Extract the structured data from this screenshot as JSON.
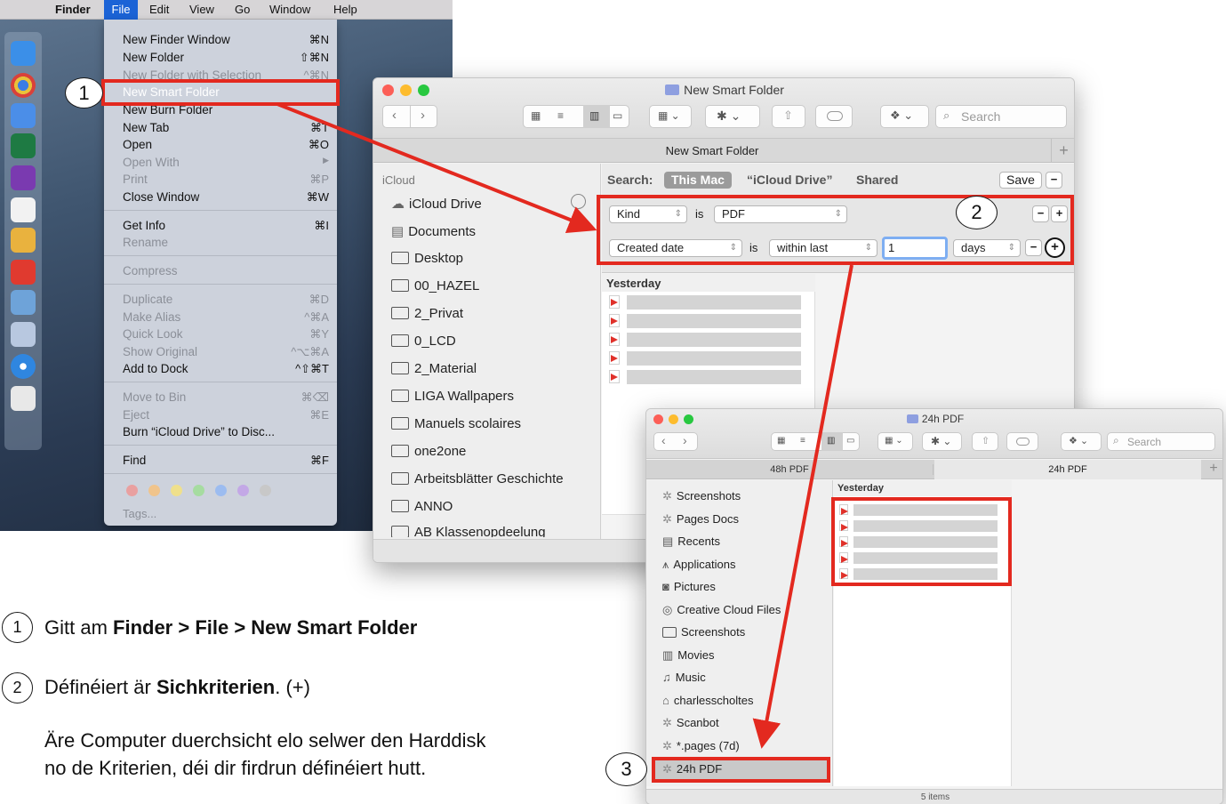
{
  "menubar": {
    "app_name": "Finder",
    "items": [
      "File",
      "Edit",
      "View",
      "Go",
      "Window",
      "Help"
    ]
  },
  "file_menu": {
    "items": [
      {
        "label": "New Finder Window",
        "shortcut": "⌘N",
        "enabled": true
      },
      {
        "label": "New Folder",
        "shortcut": "⇧⌘N",
        "enabled": true
      },
      {
        "label": "New Folder with Selection",
        "shortcut": "^⌘N",
        "enabled": false
      },
      {
        "label": "New Smart Folder",
        "shortcut": "",
        "enabled": true,
        "highlighted": true
      },
      {
        "label": "New Burn Folder",
        "shortcut": "",
        "enabled": true
      },
      {
        "label": "New Tab",
        "shortcut": "⌘T",
        "enabled": true
      },
      {
        "label": "Open",
        "shortcut": "⌘O",
        "enabled": true
      },
      {
        "label": "Open With",
        "shortcut": "▶",
        "enabled": false
      },
      {
        "label": "Print",
        "shortcut": "⌘P",
        "enabled": false
      },
      {
        "label": "Close Window",
        "shortcut": "⌘W",
        "enabled": true
      },
      {
        "label": "Get Info",
        "shortcut": "⌘I",
        "enabled": true
      },
      {
        "label": "Rename",
        "shortcut": "",
        "enabled": false
      },
      {
        "label": "Compress",
        "shortcut": "",
        "enabled": false
      },
      {
        "label": "Duplicate",
        "shortcut": "⌘D",
        "enabled": false
      },
      {
        "label": "Make Alias",
        "shortcut": "^⌘A",
        "enabled": false
      },
      {
        "label": "Quick Look",
        "shortcut": "⌘Y",
        "enabled": false
      },
      {
        "label": "Show Original",
        "shortcut": "^⌥⌘A",
        "enabled": false
      },
      {
        "label": "Add to Dock",
        "shortcut": "^⇧⌘T",
        "enabled": true
      },
      {
        "label": "Move to Bin",
        "shortcut": "⌘⌫",
        "enabled": false
      },
      {
        "label": "Eject",
        "shortcut": "⌘E",
        "enabled": false
      },
      {
        "label": "Burn “iCloud Drive” to Disc...",
        "shortcut": "",
        "enabled": true
      },
      {
        "label": "Find",
        "shortcut": "⌘F",
        "enabled": true
      },
      {
        "label": "Tags...",
        "shortcut": "",
        "enabled": false
      }
    ],
    "tag_colors": [
      "#e9a0a0",
      "#f0c48c",
      "#efe08c",
      "#a6dca0",
      "#9cbcf0",
      "#c3a8e6",
      "#c8c8c8"
    ]
  },
  "smart_window": {
    "title": "New Smart Folder",
    "tab_label": "New Smart Folder",
    "search_placeholder": "Search",
    "sidebar_header": "iCloud",
    "sidebar_items": [
      "iCloud Drive",
      "Documents",
      "Desktop",
      "00_HAZEL",
      "2_Privat",
      "0_LCD",
      "2_Material",
      "LIGA Wallpapers",
      "Manuels scolaires",
      "one2one",
      "Arbeitsblätter Geschichte",
      "ANNO",
      "AB Klassenopdeelung"
    ],
    "search_label": "Search:",
    "scope_this_mac": "This Mac",
    "scope_icloud": "“iCloud Drive”",
    "scope_shared": "Shared",
    "save_label": "Save",
    "rule1": {
      "attribute": "Kind",
      "op": "is",
      "value": "PDF"
    },
    "rule2": {
      "attribute": "Created date",
      "op": "is",
      "qualifier": "within last",
      "value": "1",
      "unit": "days"
    },
    "results_header": "Yesterday"
  },
  "pdf_window": {
    "title": "24h PDF",
    "tabs": [
      "48h PDF",
      "24h PDF"
    ],
    "search_placeholder": "Search",
    "sidebar_items": [
      "Screenshots",
      "Pages Docs",
      "Recents",
      "Applications",
      "Pictures",
      "Creative Cloud Files",
      "Screenshots",
      "Movies",
      "Music",
      "charlesscholtes",
      "Scanbot",
      "*.pages (7d)",
      "24h PDF"
    ],
    "results_header": "Yesterday",
    "status": "5 items"
  },
  "callouts": [
    "1",
    "2",
    "3"
  ],
  "instructions": {
    "step1_prefix": "Gitt am ",
    "step1_bold": "Finder > File > New Smart Folder",
    "step2_prefix": "Définéiert är ",
    "step2_bold": "Sichkriterien",
    "step2_suffix": ". (+)",
    "note_line1": "Äre Computer duerchsicht elo selwer den Harddisk",
    "note_line2": "no de Kriterien, déi dir firdrun définéiert hutt."
  },
  "accent_colors": {
    "selection": "#1d5fd5",
    "annotation": "#e3291f"
  }
}
